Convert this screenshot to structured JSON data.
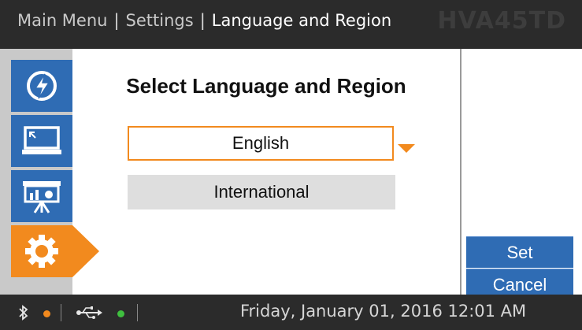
{
  "header": {
    "breadcrumb": [
      "Main Menu",
      "Settings",
      "Language and Region"
    ],
    "separator": "|",
    "model": "HVA45TD"
  },
  "sidebar": {
    "items": [
      {
        "icon": "power-icon",
        "active": false
      },
      {
        "icon": "display-icon",
        "active": false
      },
      {
        "icon": "presentation-icon",
        "active": false
      },
      {
        "icon": "gear-icon",
        "active": true
      }
    ]
  },
  "main": {
    "title": "Select Language and Region",
    "language": {
      "value": "English"
    },
    "region": {
      "value": "International"
    }
  },
  "actions": {
    "set_label": "Set",
    "cancel_label": "Cancel"
  },
  "status": {
    "datetime": "Friday, January 01, 2016 12:01 AM"
  },
  "colors": {
    "accent": "#f28a1e",
    "primary": "#2f6cb4",
    "bar": "#2b2b2b",
    "sidebar": "#c9c9c9"
  }
}
